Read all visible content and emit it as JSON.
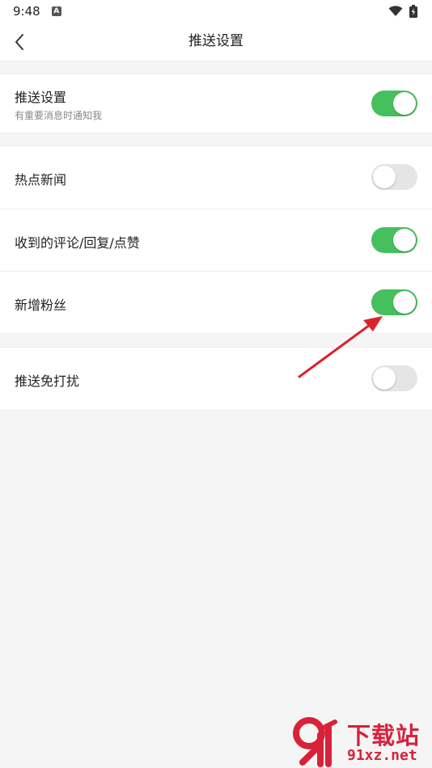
{
  "status_bar": {
    "time": "9:48"
  },
  "header": {
    "title": "推送设置"
  },
  "sections": [
    [
      {
        "title": "推送设置",
        "subtitle": "有重要消息时通知我",
        "on": true
      }
    ],
    [
      {
        "title": "热点新闻",
        "on": false
      },
      {
        "title": "收到的评论/回复/点赞",
        "on": true
      },
      {
        "title": "新增粉丝",
        "on": true
      }
    ],
    [
      {
        "title": "推送免打扰",
        "on": false
      }
    ]
  ],
  "watermark": {
    "title": "下载站",
    "url": "91xz.net"
  },
  "colors": {
    "switch_on": "#45c05d",
    "switch_off": "#e5e5e5",
    "annotation_arrow": "#d9232e",
    "watermark": "#d8223a"
  }
}
